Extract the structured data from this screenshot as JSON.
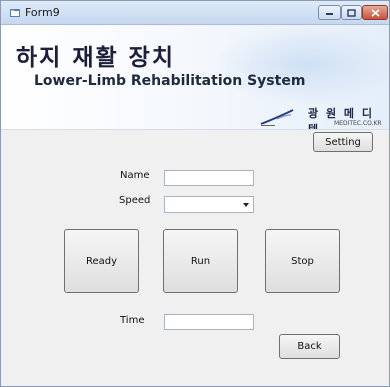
{
  "window": {
    "title": "Form9"
  },
  "banner": {
    "title_kr": "하지 재활 장치",
    "title_en": "Lower-Limb Rehabilitation System",
    "company_kr": "광 원 메 디 텍",
    "company_url": "MEDITEC.CO.KR"
  },
  "toolbar": {
    "setting_label": "Setting"
  },
  "form": {
    "name_label": "Name",
    "name_value": "",
    "speed_label": "Speed",
    "speed_selected": "",
    "time_label": "Time",
    "time_value": ""
  },
  "controls": {
    "ready_label": "Ready",
    "run_label": "Run",
    "stop_label": "Stop",
    "back_label": "Back"
  },
  "icons": {
    "app": "form-icon",
    "minimize": "minimize-icon",
    "maximize": "maximize-icon",
    "close": "close-icon",
    "logo": "company-logo-icon",
    "dropdown": "chevron-down-icon"
  },
  "colors": {
    "title_text": "#1d1e3a",
    "close_button": "#c8523b",
    "banner_accent": "#cfe0f4"
  }
}
